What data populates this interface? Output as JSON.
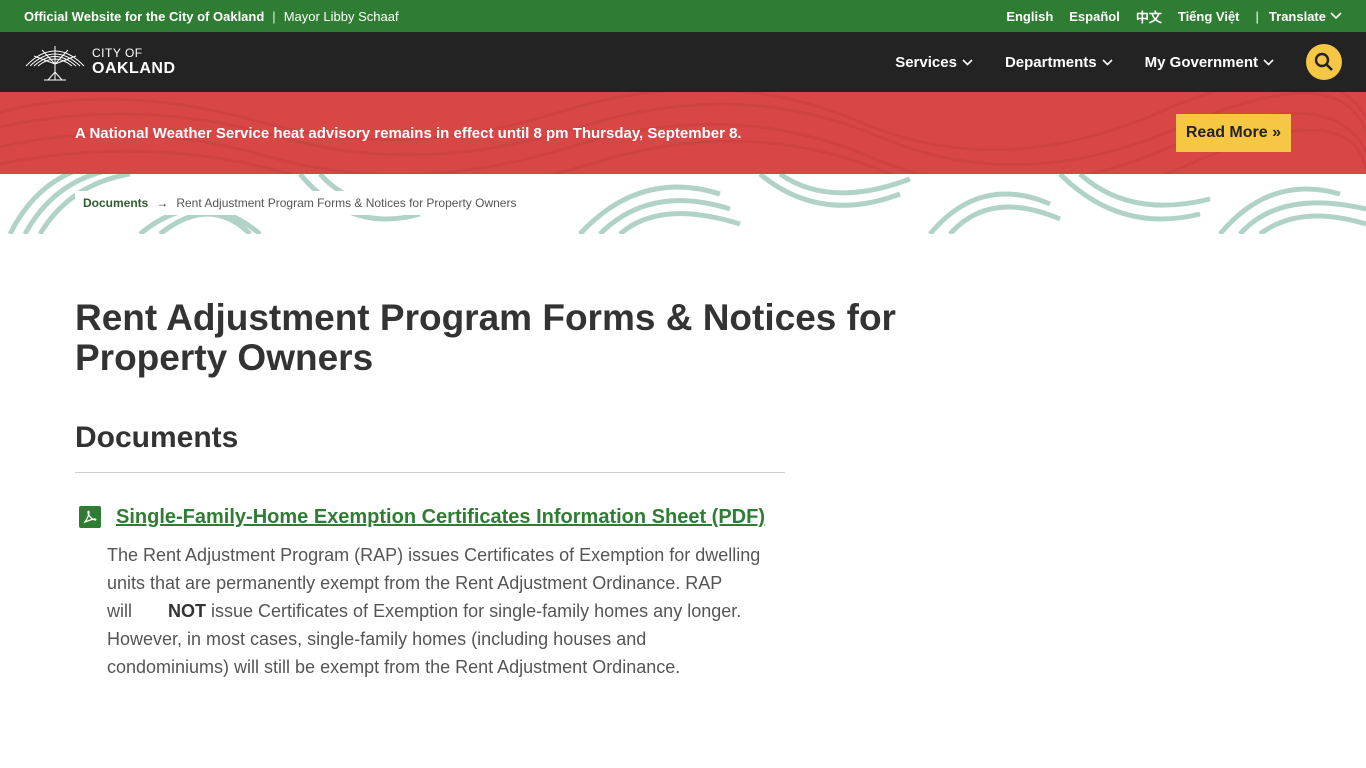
{
  "topbar": {
    "official_label": "Official Website for the City of Oakland",
    "separator": "|",
    "mayor_label": "Mayor Libby Schaaf",
    "languages": [
      "English",
      "Español",
      "中文",
      "Tiếng Việt"
    ],
    "translate_label": "Translate"
  },
  "nav": {
    "logo_city": "CITY OF",
    "logo_name": "OAKLAND",
    "items": [
      "Services",
      "Departments",
      "My Government"
    ]
  },
  "alert": {
    "message": "A National Weather Service heat advisory remains in effect until 8 pm Thursday, September 8.",
    "button_label": "Read More »"
  },
  "breadcrumb": {
    "parent": "Documents",
    "arrow": "→",
    "current": "Rent Adjustment Program Forms & Notices for Property Owners"
  },
  "page": {
    "title": "Rent Adjustment Program Forms & Notices for Property Owners",
    "section_title": "Documents"
  },
  "documents": [
    {
      "link_text": "Single-Family-Home Exemption Certificates Information Sheet (PDF)",
      "desc_before": "The Rent Adjustment Program (RAP) issues Certificates of Exemption for dwelling units that are permanently exempt from the Rent Adjustment Ordinance. RAP will",
      "desc_bold": "NOT",
      "desc_after": " issue Certificates of Exemption for single-family homes any longer. However, in most cases, single-family homes (including houses and condominiums) will still be exempt from the Rent Adjustment Ordinance."
    }
  ],
  "colors": {
    "topbar_green": "#2f7d32",
    "nav_dark": "#232323",
    "alert_red": "#d94646",
    "accent_yellow": "#f6c744",
    "link_green": "#2f7d32"
  }
}
